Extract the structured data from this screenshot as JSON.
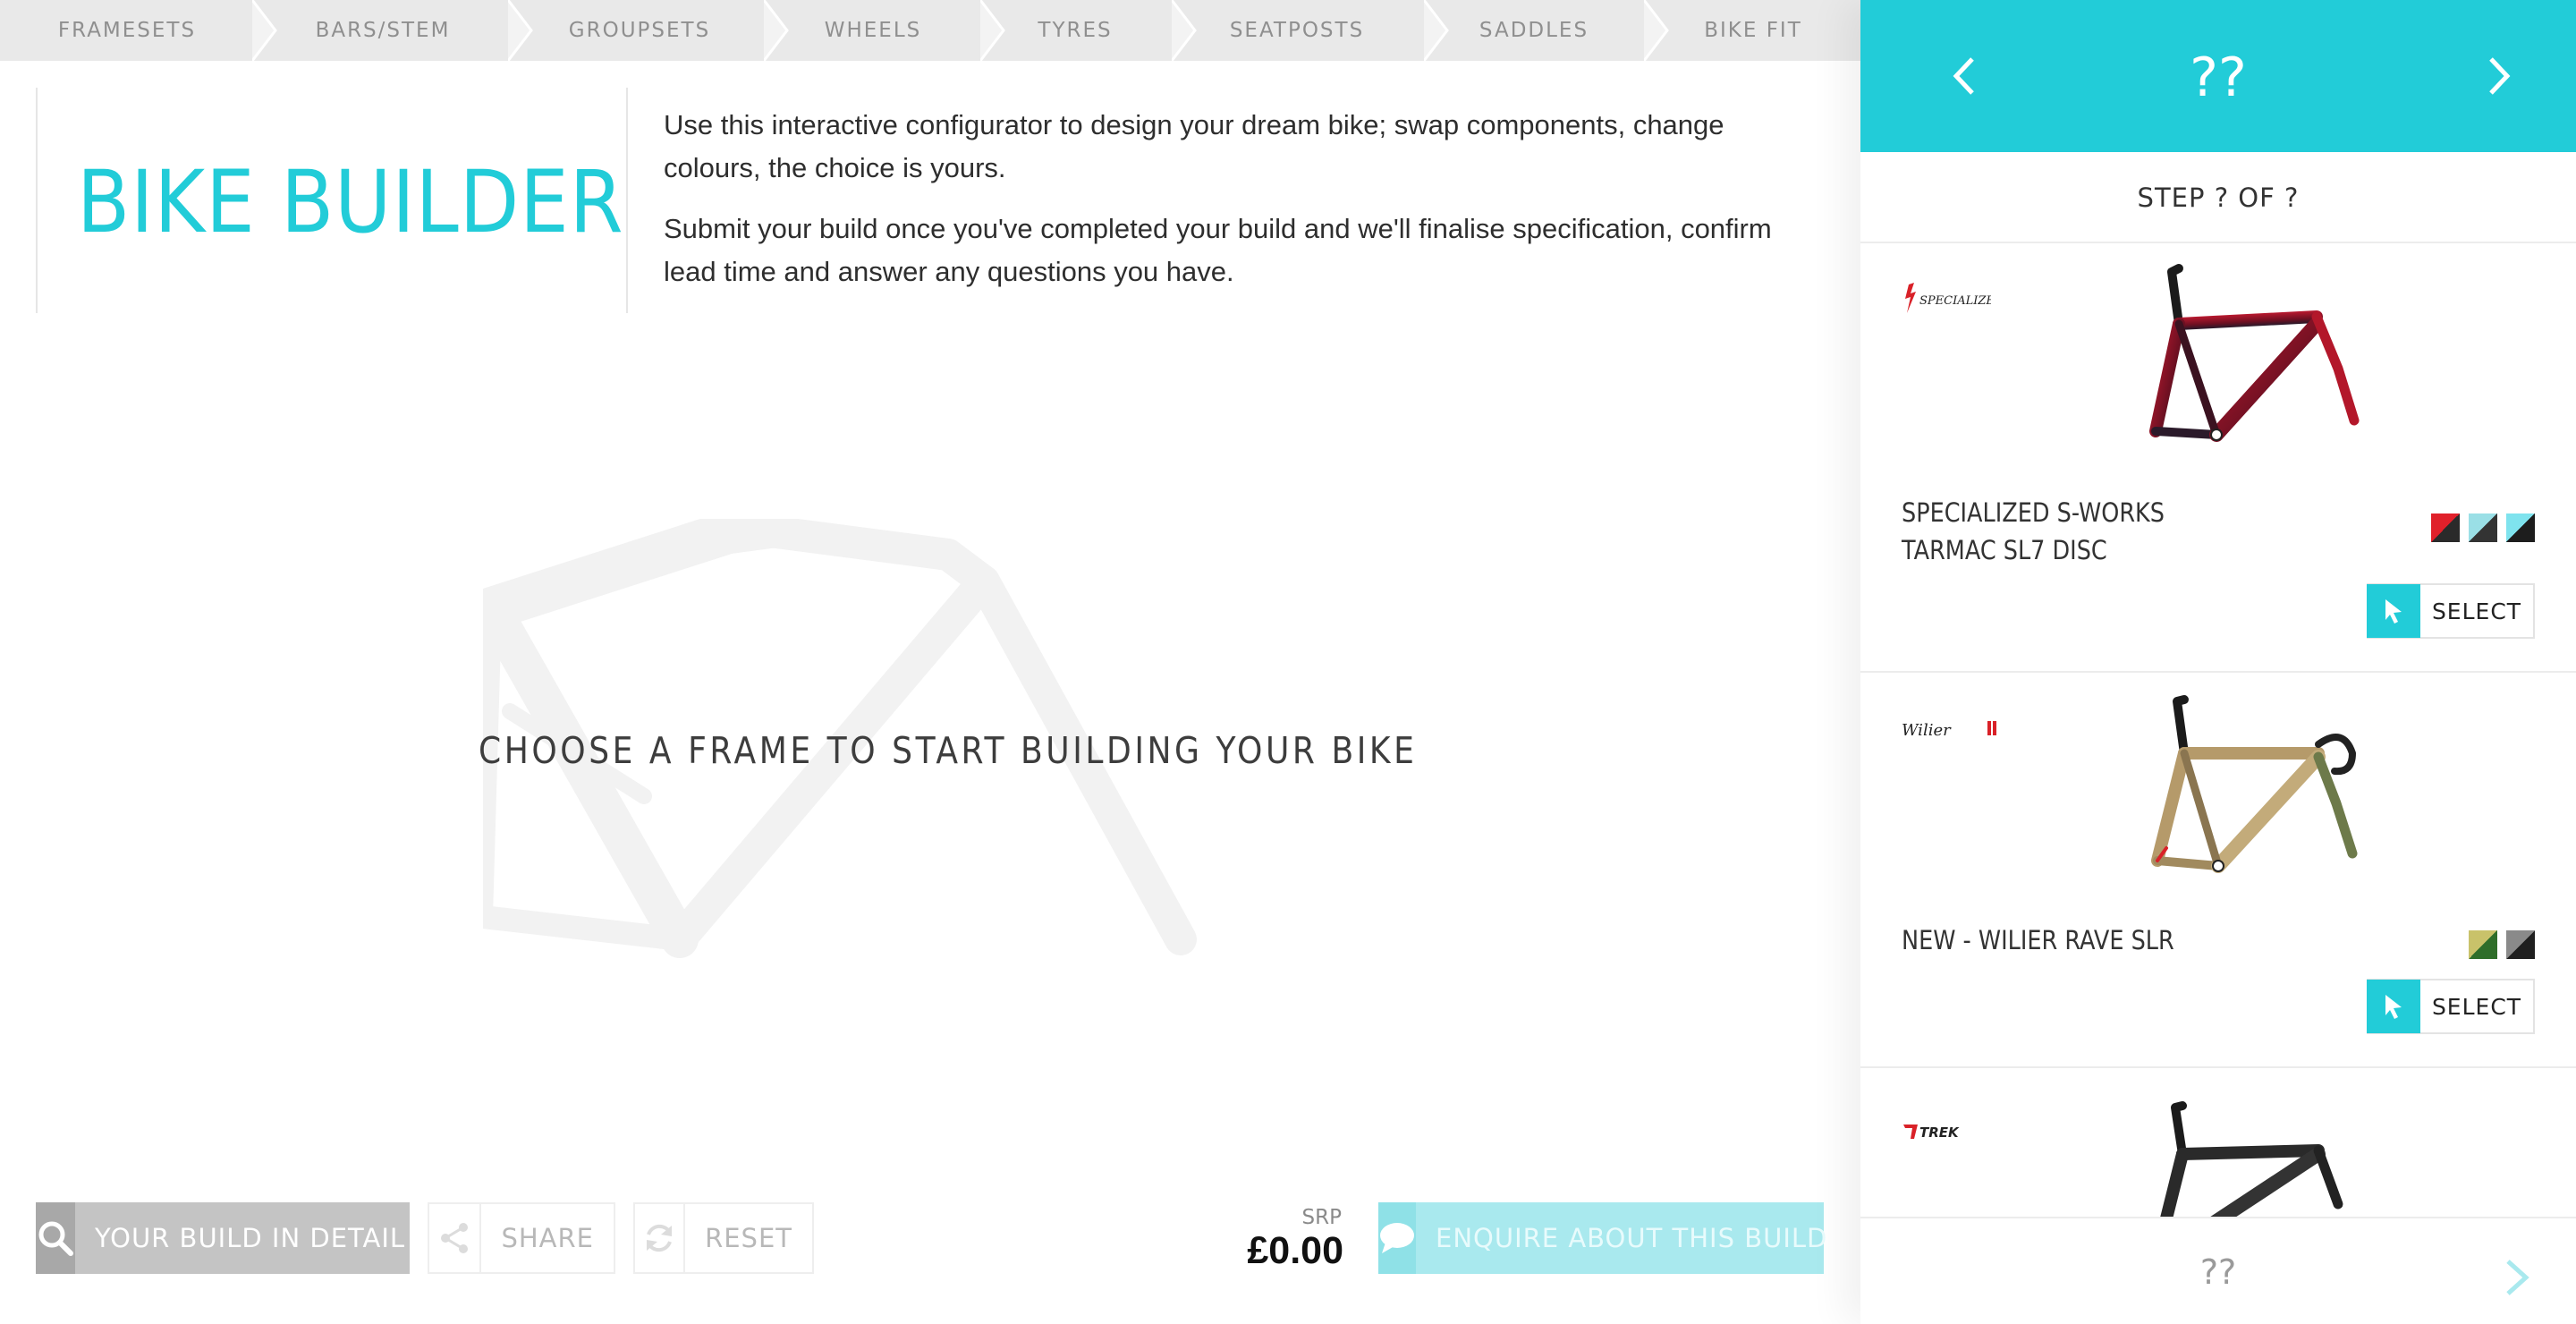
{
  "step_nav": {
    "items": [
      "FRAMESETS",
      "BARS/STEM",
      "GROUPSETS",
      "WHEELS",
      "TYRES",
      "SEATPOSTS",
      "SADDLES",
      "BIKE FIT"
    ]
  },
  "header": {
    "title": "BIKE BUILDER",
    "intro_1": "Use this interactive configurator to design your dream bike; swap components, change colours, the choice is yours.",
    "intro_2": "Submit your build once you've completed your build and we'll finalise specification, confirm lead time and answer any questions you have."
  },
  "canvas": {
    "prompt": "CHOOSE A FRAME TO START BUILDING YOUR BIKE"
  },
  "actions": {
    "detail_label": "YOUR BUILD IN DETAIL",
    "share_label": "SHARE",
    "reset_label": "RESET",
    "enquire_label": "ENQUIRE ABOUT THIS BUILD",
    "srp_label": "SRP",
    "srp_value": "£0.00"
  },
  "sidebar": {
    "title": "??",
    "step_text": "STEP ? OF ?",
    "footer_text": "??",
    "select_label": "SELECT",
    "products": [
      {
        "brand": "SPECIALIZED",
        "name_line1": "SPECIALIZED S-WORKS",
        "name_line2": "TARMAC SL7 DISC",
        "swatches": [
          [
            "#e0202a",
            "#2a2a2a"
          ],
          [
            "#9adfe6",
            "#333333"
          ],
          [
            "#7fe3ee",
            "#1d1d1d"
          ]
        ]
      },
      {
        "brand": "Wilier",
        "name_line1": "NEW - WILIER RAVE SLR",
        "name_line2": "",
        "swatches": [
          [
            "#c9c26a",
            "#2f6e2a"
          ],
          [
            "#8a8a8a",
            "#1f1f1f"
          ]
        ]
      },
      {
        "brand": "TREK",
        "name_line1": "",
        "name_line2": "",
        "swatches": []
      }
    ]
  },
  "colors": {
    "accent": "#22ccd8",
    "accent_light": "#a9e9ee",
    "nav_bg": "#e9e9e9",
    "muted_text": "#8f8f8f"
  }
}
